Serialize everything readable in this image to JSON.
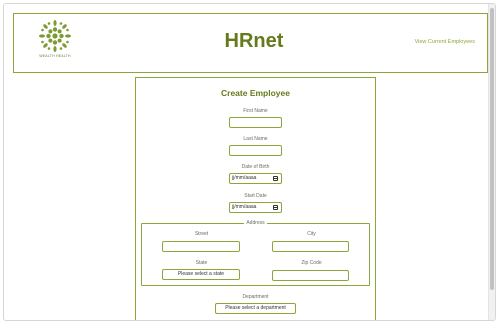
{
  "header": {
    "logo_text": "WEALTH HEALTH",
    "title": "HRnet",
    "view_employees_link": "View Current Employees"
  },
  "form": {
    "title": "Create Employee",
    "first_name_label": "First Name",
    "last_name_label": "Last Name",
    "dob_label": "Date of Birth",
    "dob_placeholder": "jj/mm/aaaa",
    "start_date_label": "Start Date",
    "start_date_placeholder": "jj/mm/aaaa",
    "address": {
      "legend": "Address",
      "street_label": "Street",
      "city_label": "City",
      "state_label": "State",
      "state_selected": "Please select a state",
      "zip_label": "Zip Code"
    },
    "department_label": "Department",
    "department_selected": "Please select a department"
  },
  "colors": {
    "accent": "#8aa83a",
    "title": "#657a1a"
  }
}
